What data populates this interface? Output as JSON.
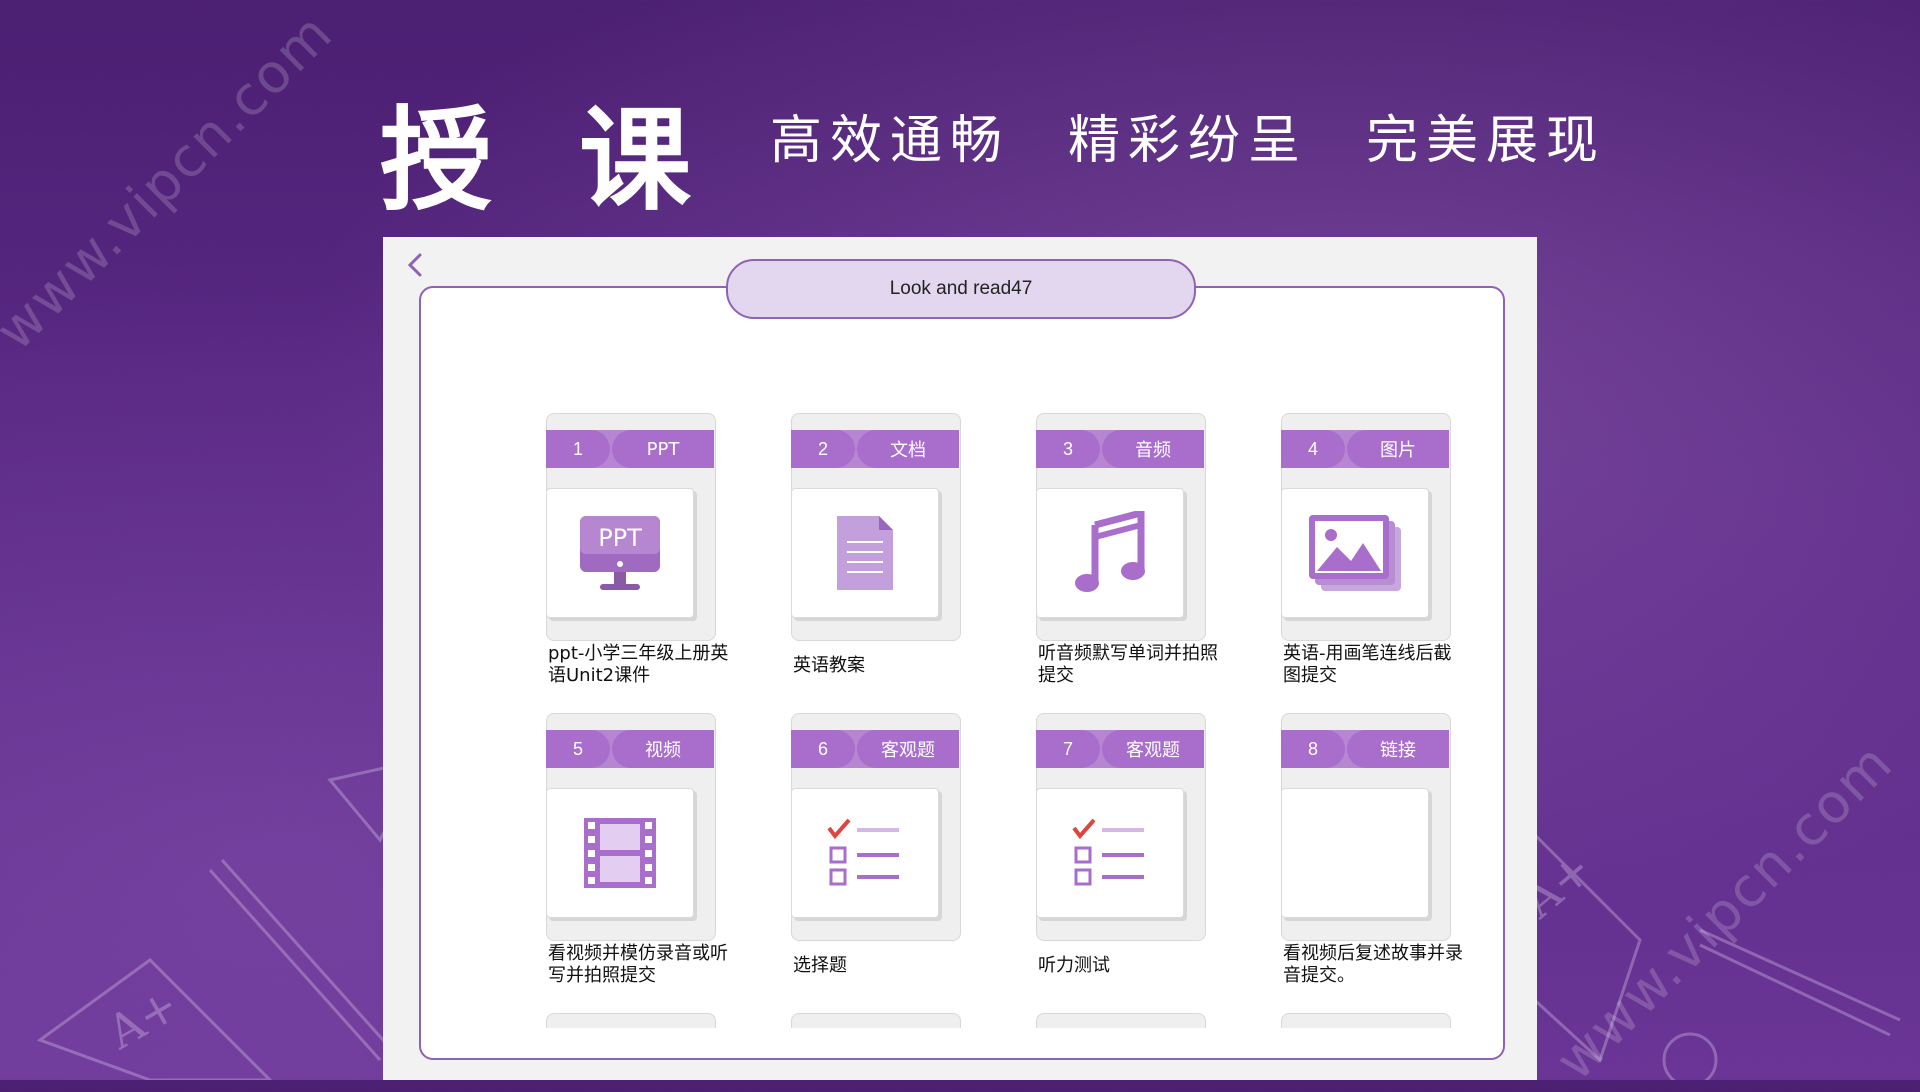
{
  "watermark": "www.vipcn.com",
  "header": {
    "title": "授 课",
    "slogans": [
      "高效通畅",
      "精彩纷呈",
      "完美展现"
    ]
  },
  "app": {
    "back_icon": "chevron-left-icon",
    "lesson_title": "Look and read47",
    "items": [
      {
        "num": "1",
        "type": "PPT",
        "caption": "ppt-小学三年级上册英语Unit2课件",
        "icon": "ppt-monitor-icon"
      },
      {
        "num": "2",
        "type": "文档",
        "caption": "英语教案",
        "icon": "document-icon"
      },
      {
        "num": "3",
        "type": "音频",
        "caption": "听音频默写单词并拍照提交",
        "icon": "music-note-icon"
      },
      {
        "num": "4",
        "type": "图片",
        "caption": "英语-用画笔连线后截图提交",
        "icon": "image-gallery-icon"
      },
      {
        "num": "5",
        "type": "视频",
        "caption": "看视频并模仿录音或听写并拍照提交",
        "icon": "film-icon"
      },
      {
        "num": "6",
        "type": "客观题",
        "caption": "选择题",
        "icon": "checklist-icon"
      },
      {
        "num": "7",
        "type": "客观题",
        "caption": "听力测试",
        "icon": "checklist-icon"
      },
      {
        "num": "8",
        "type": "链接",
        "caption": "看视频后复述故事并录音提交。",
        "icon": "blank-link-thumb"
      }
    ]
  },
  "colors": {
    "background": "#5b2a86",
    "accent": "#a96dcc",
    "frame": "#8e63b3",
    "title_pill": "#e3d7ef",
    "check": "#e0453d"
  }
}
